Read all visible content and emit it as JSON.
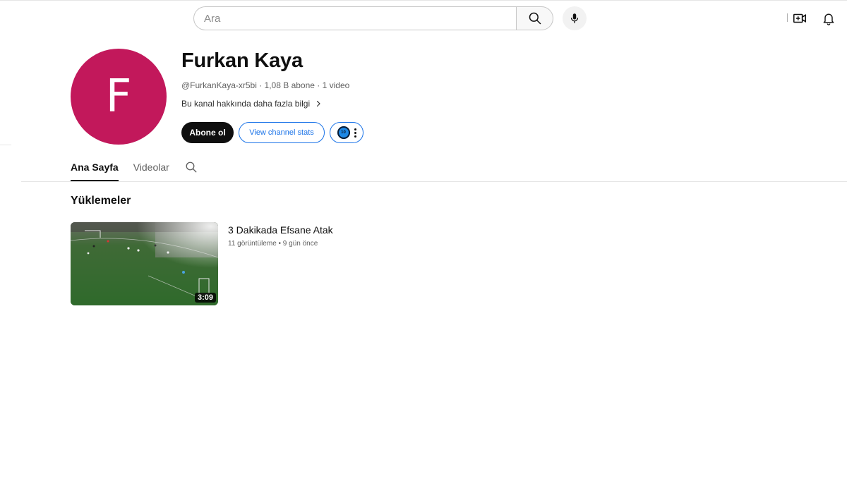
{
  "header": {
    "search": {
      "placeholder": "Ara",
      "value": ""
    }
  },
  "icons": {
    "search": "search-icon",
    "mic": "mic-icon",
    "create": "create-video-icon",
    "notifications": "bell-icon",
    "chevron": "chevron-right-icon",
    "more": "more-vert-icon"
  },
  "channel": {
    "avatar_letter": "F",
    "avatar_color": "#c2185b",
    "name": "Furkan Kaya",
    "meta": "@FurkanKaya-xr5bi · 1,08 B abone · 1 video",
    "about": "Bu kanal hakkında daha fazla bilgi",
    "subscribe_label": "Abone ol",
    "stats_label": "View channel stats",
    "extension_logo": "10"
  },
  "tabs": [
    {
      "label": "Ana Sayfa",
      "active": true
    },
    {
      "label": "Videolar",
      "active": false
    }
  ],
  "uploads": {
    "title": "Yüklemeler",
    "videos": [
      {
        "title": "3 Dakikada Efsane Atak",
        "meta": "11 görüntüleme • 9 gün önce",
        "duration": "3:09"
      }
    ]
  },
  "colors": {
    "accent": "#1a73e8",
    "text": "#0f0f0f",
    "muted": "#606060"
  }
}
